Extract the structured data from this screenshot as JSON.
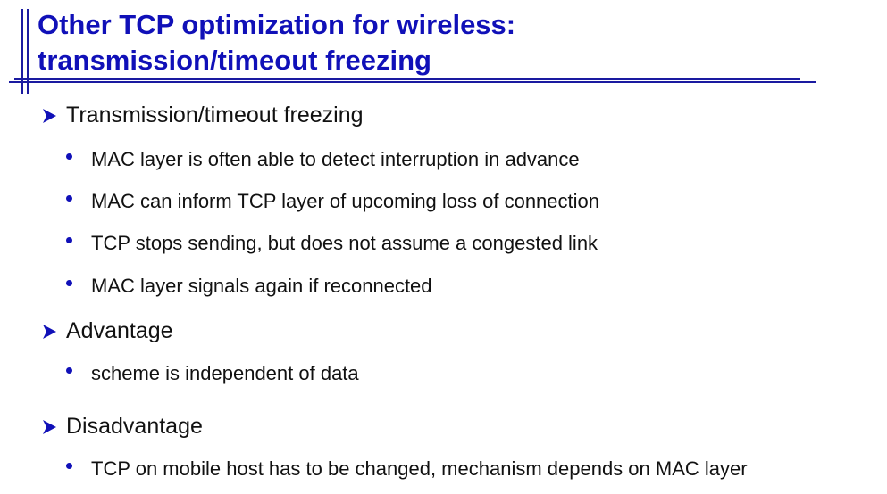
{
  "title": {
    "line1": "Other TCP optimization for wireless:",
    "line2": "transmission/timeout freezing"
  },
  "sections": [
    {
      "heading": "Transmission/timeout freezing",
      "bullets": [
        "MAC layer is often able to detect interruption in advance",
        "MAC can inform TCP layer of upcoming loss of connection",
        "TCP stops sending, but does not assume a congested link",
        "MAC layer signals again if reconnected"
      ]
    },
    {
      "heading": "Advantage",
      "bullets": [
        "scheme is independent of data"
      ]
    },
    {
      "heading": "Disadvantage",
      "bullets": [
        "TCP on mobile host has to be changed, mechanism depends on MAC layer"
      ]
    }
  ],
  "colors": {
    "accent": "#1010b8",
    "text": "#111111",
    "background": "#ffffff"
  },
  "icons": {
    "section_marker": "arrowhead-bullet-icon",
    "item_marker": "round-bullet-icon"
  }
}
